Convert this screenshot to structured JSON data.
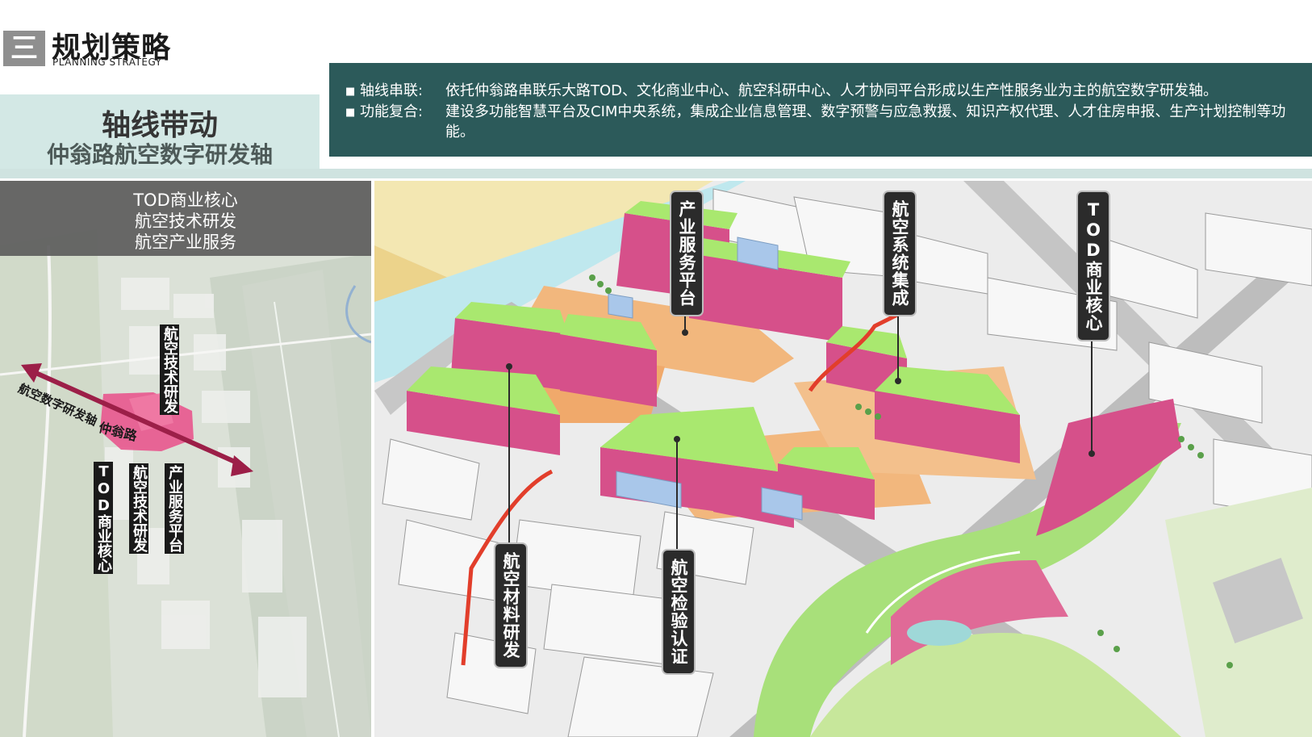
{
  "header": {
    "section_number": "三",
    "title": "规划策略",
    "subtitle": "PLANNING STRATEGY"
  },
  "theme": {
    "title": "轴线带动",
    "subtitle": "仲翁路航空数字研发轴"
  },
  "strategy": {
    "items": [
      {
        "label": "轴线串联:",
        "text": "依托仲翁路串联乐大路TOD、文化商业中心、航空科研中心、人才协同平台形成以生产性服务业为主的航空数字研发轴。"
      },
      {
        "label": "功能复合:",
        "text": "建设多功能智慧平台及CIM中央系统，集成企业信息管理、数字预警与应急救援、知识产权代理、人才住房申报、生产计划控制等功能。"
      }
    ]
  },
  "functions": [
    "TOD商业核心",
    "航空技术研发",
    "航空产业服务"
  ],
  "map": {
    "axis_label": "航空数字研发轴",
    "road_label": "仲翁路",
    "zone_labels": {
      "tech_top": "航空技术研发",
      "tod": "TOD商业核心",
      "tech_bottom": "航空技术研发",
      "service": "产业服务平台"
    }
  },
  "render_labels": {
    "service_platform": "产业服务平台",
    "system_integration": "航空系统集成",
    "tod_core": "TOD商业核心",
    "materials": "航空材料研发",
    "inspection": "航空检验认证"
  },
  "colors": {
    "panel": "#2c5a5a",
    "band": "#d3e8e5",
    "building_roof": "#a9e86f",
    "building_facade": "#d6508a",
    "axis_arrow": "#9c1f48",
    "label_bg": "#2b2b2b"
  }
}
